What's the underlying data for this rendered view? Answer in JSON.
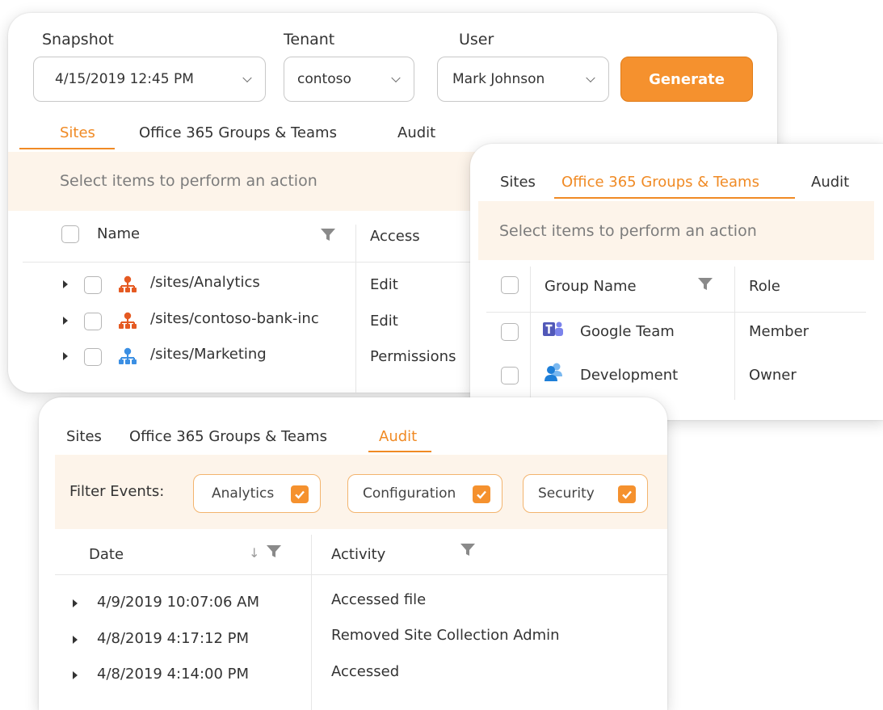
{
  "colors": {
    "accent": "#f5912e",
    "band": "#fdf4ea",
    "site_orange": "#e55a22",
    "site_blue": "#3b8fe3",
    "teams_purple": "#5158b8"
  },
  "snapshot_panel": {
    "snapshot_label": "Snapshot",
    "snapshot_value": "4/15/2019 12:45 PM",
    "tenant_label": "Tenant",
    "tenant_value": "contoso",
    "user_label": "User",
    "user_value": "Mark Johnson",
    "generate_label": "Generate",
    "tabs": [
      {
        "label": "Sites",
        "active": true
      },
      {
        "label": "Office 365 Groups & Teams",
        "active": false
      },
      {
        "label": "Audit",
        "active": false
      }
    ],
    "action_hint": "Select items to perform an action",
    "columns": {
      "name": "Name",
      "access": "Access"
    },
    "rows": [
      {
        "name": "/sites/Analytics",
        "access": "Edit",
        "icon": "site-hierarchy-orange-icon"
      },
      {
        "name": "/sites/contoso-bank-inc",
        "access": "Edit",
        "icon": "site-hierarchy-orange-icon"
      },
      {
        "name": "/sites/Marketing",
        "access": "Permissions",
        "icon": "site-hierarchy-blue-icon"
      }
    ]
  },
  "groups_panel": {
    "tabs": [
      {
        "label": "Sites",
        "active": false
      },
      {
        "label": "Office 365 Groups & Teams",
        "active": true
      },
      {
        "label": "Audit",
        "active": false
      }
    ],
    "action_hint": "Select items to perform an action",
    "columns": {
      "group_name": "Group Name",
      "role": "Role"
    },
    "rows": [
      {
        "name": "Google Team",
        "role": "Member",
        "icon": "teams-icon"
      },
      {
        "name": "Development",
        "role": "Owner",
        "icon": "group-people-icon"
      }
    ]
  },
  "audit_panel": {
    "tabs": [
      {
        "label": "Sites",
        "active": false
      },
      {
        "label": "Office 365 Groups & Teams",
        "active": false
      },
      {
        "label": "Audit",
        "active": true
      }
    ],
    "filter_label": "Filter Events:",
    "filters": [
      {
        "label": "Analytics",
        "checked": true
      },
      {
        "label": "Configuration",
        "checked": true
      },
      {
        "label": "Security",
        "checked": true
      }
    ],
    "columns": {
      "date": "Date",
      "activity": "Activity"
    },
    "rows": [
      {
        "date": "4/9/2019 10:07:06 AM",
        "activity": "Accessed file"
      },
      {
        "date": "4/8/2019 4:17:12 PM",
        "activity": "Removed Site Collection Admin"
      },
      {
        "date": "4/8/2019 4:14:00 PM",
        "activity": "Accessed"
      }
    ]
  }
}
